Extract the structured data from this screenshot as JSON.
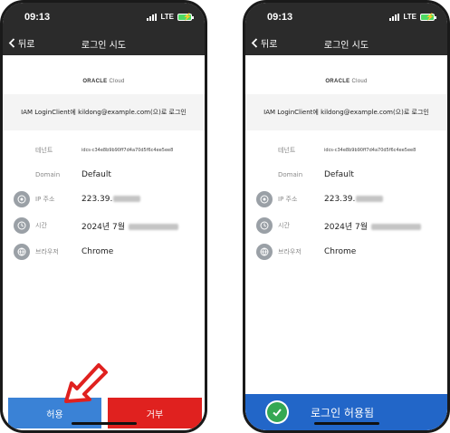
{
  "status": {
    "time": "09:13",
    "network": "LTE"
  },
  "nav": {
    "back_label": "뒤로",
    "title": "로그인 시도"
  },
  "logo": {
    "brand": "ORACLE",
    "product": "Cloud"
  },
  "request": {
    "text": "IAM LoginClient에 kildong@example.com(으)로 로그인"
  },
  "details": {
    "tenant": {
      "label": "테넌트",
      "value": "idcs-c34e8b9b90ff7d4a70d5f6c4ee5ee8"
    },
    "domain": {
      "label": "Domain",
      "value": "Default"
    },
    "ip": {
      "label": "IP 주소",
      "value": "223.39."
    },
    "time": {
      "label": "시간",
      "value": "2024년 7월"
    },
    "browser": {
      "label": "브라우저",
      "value": "Chrome"
    }
  },
  "actions": {
    "allow_label": "허용",
    "deny_label": "거부"
  },
  "result": {
    "allowed_label": "로그인 허용됨"
  },
  "colors": {
    "allow": "#3a82d6",
    "deny": "#e0211f",
    "banner": "#2266c8",
    "check": "#34a853",
    "arrow": "#e0211f"
  }
}
